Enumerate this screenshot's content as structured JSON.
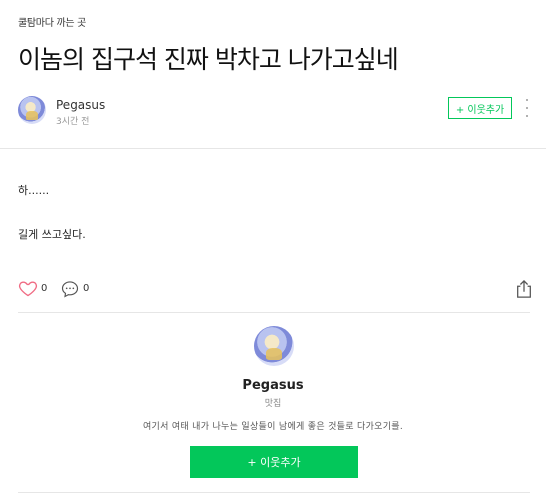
{
  "post": {
    "category": "쿨탐마다 까는 곳",
    "title": "이놈의 집구석 진짜 박차고 나가고싶네",
    "author": "Pegasus",
    "time": "3시간 전",
    "follow_label": "+ 이웃추가",
    "content": [
      "하......",
      "길게 쓰고싶다."
    ],
    "likes": "0",
    "comments": "0"
  },
  "profile": {
    "name": "Pegasus",
    "blog_name": "맛집",
    "description": "여기서 여태 내가 나누는 일상들이 남에게 좋은 것들로 다가오기를.",
    "follow_label": "+ 이웃추가"
  },
  "icons": [
    "heart-icon",
    "comment-icon",
    "share-icon",
    "more-icon"
  ],
  "colors": {
    "accent": "#03c75a",
    "heart": "#f06c84"
  }
}
